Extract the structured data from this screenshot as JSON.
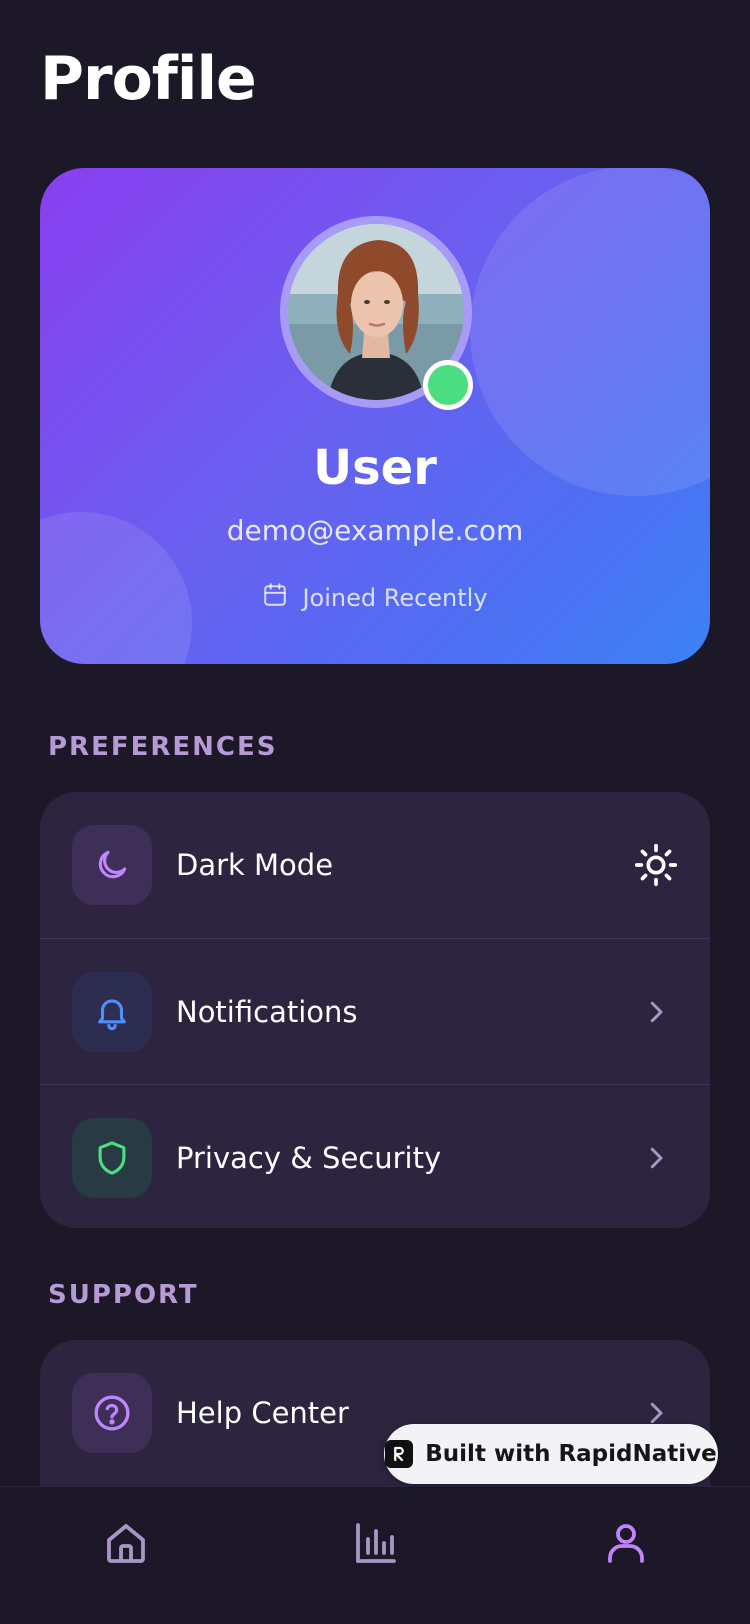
{
  "page": {
    "title": "Profile"
  },
  "profile": {
    "name": "User",
    "email": "demo@example.com",
    "joined": "Joined Recently",
    "status": "online"
  },
  "preferences": {
    "label": "PREFERENCES",
    "items": [
      {
        "label": "Dark Mode",
        "icon": "moon-icon",
        "trailing": "sun-icon"
      },
      {
        "label": "Notifications",
        "icon": "bell-icon",
        "trailing": "chevron-right-icon"
      },
      {
        "label": "Privacy & Security",
        "icon": "shield-icon",
        "trailing": "chevron-right-icon"
      }
    ]
  },
  "support": {
    "label": "SUPPORT",
    "items": [
      {
        "label": "Help Center",
        "icon": "help-circle-icon",
        "trailing": "chevron-right-icon"
      }
    ]
  },
  "badge": {
    "label": "Built with RapidNative"
  },
  "tabs": [
    {
      "name": "home",
      "icon": "home-icon",
      "active": false
    },
    {
      "name": "stats",
      "icon": "bar-chart-icon",
      "active": false
    },
    {
      "name": "profile",
      "icon": "user-icon",
      "active": true
    }
  ],
  "colors": {
    "background": "#1c1828",
    "card": "#2d2440",
    "accent": "#b374f0",
    "section_label": "#b59ad6",
    "online": "#4ade80",
    "gradient_start": "#8a3ff0",
    "gradient_end": "#3b82f6"
  }
}
